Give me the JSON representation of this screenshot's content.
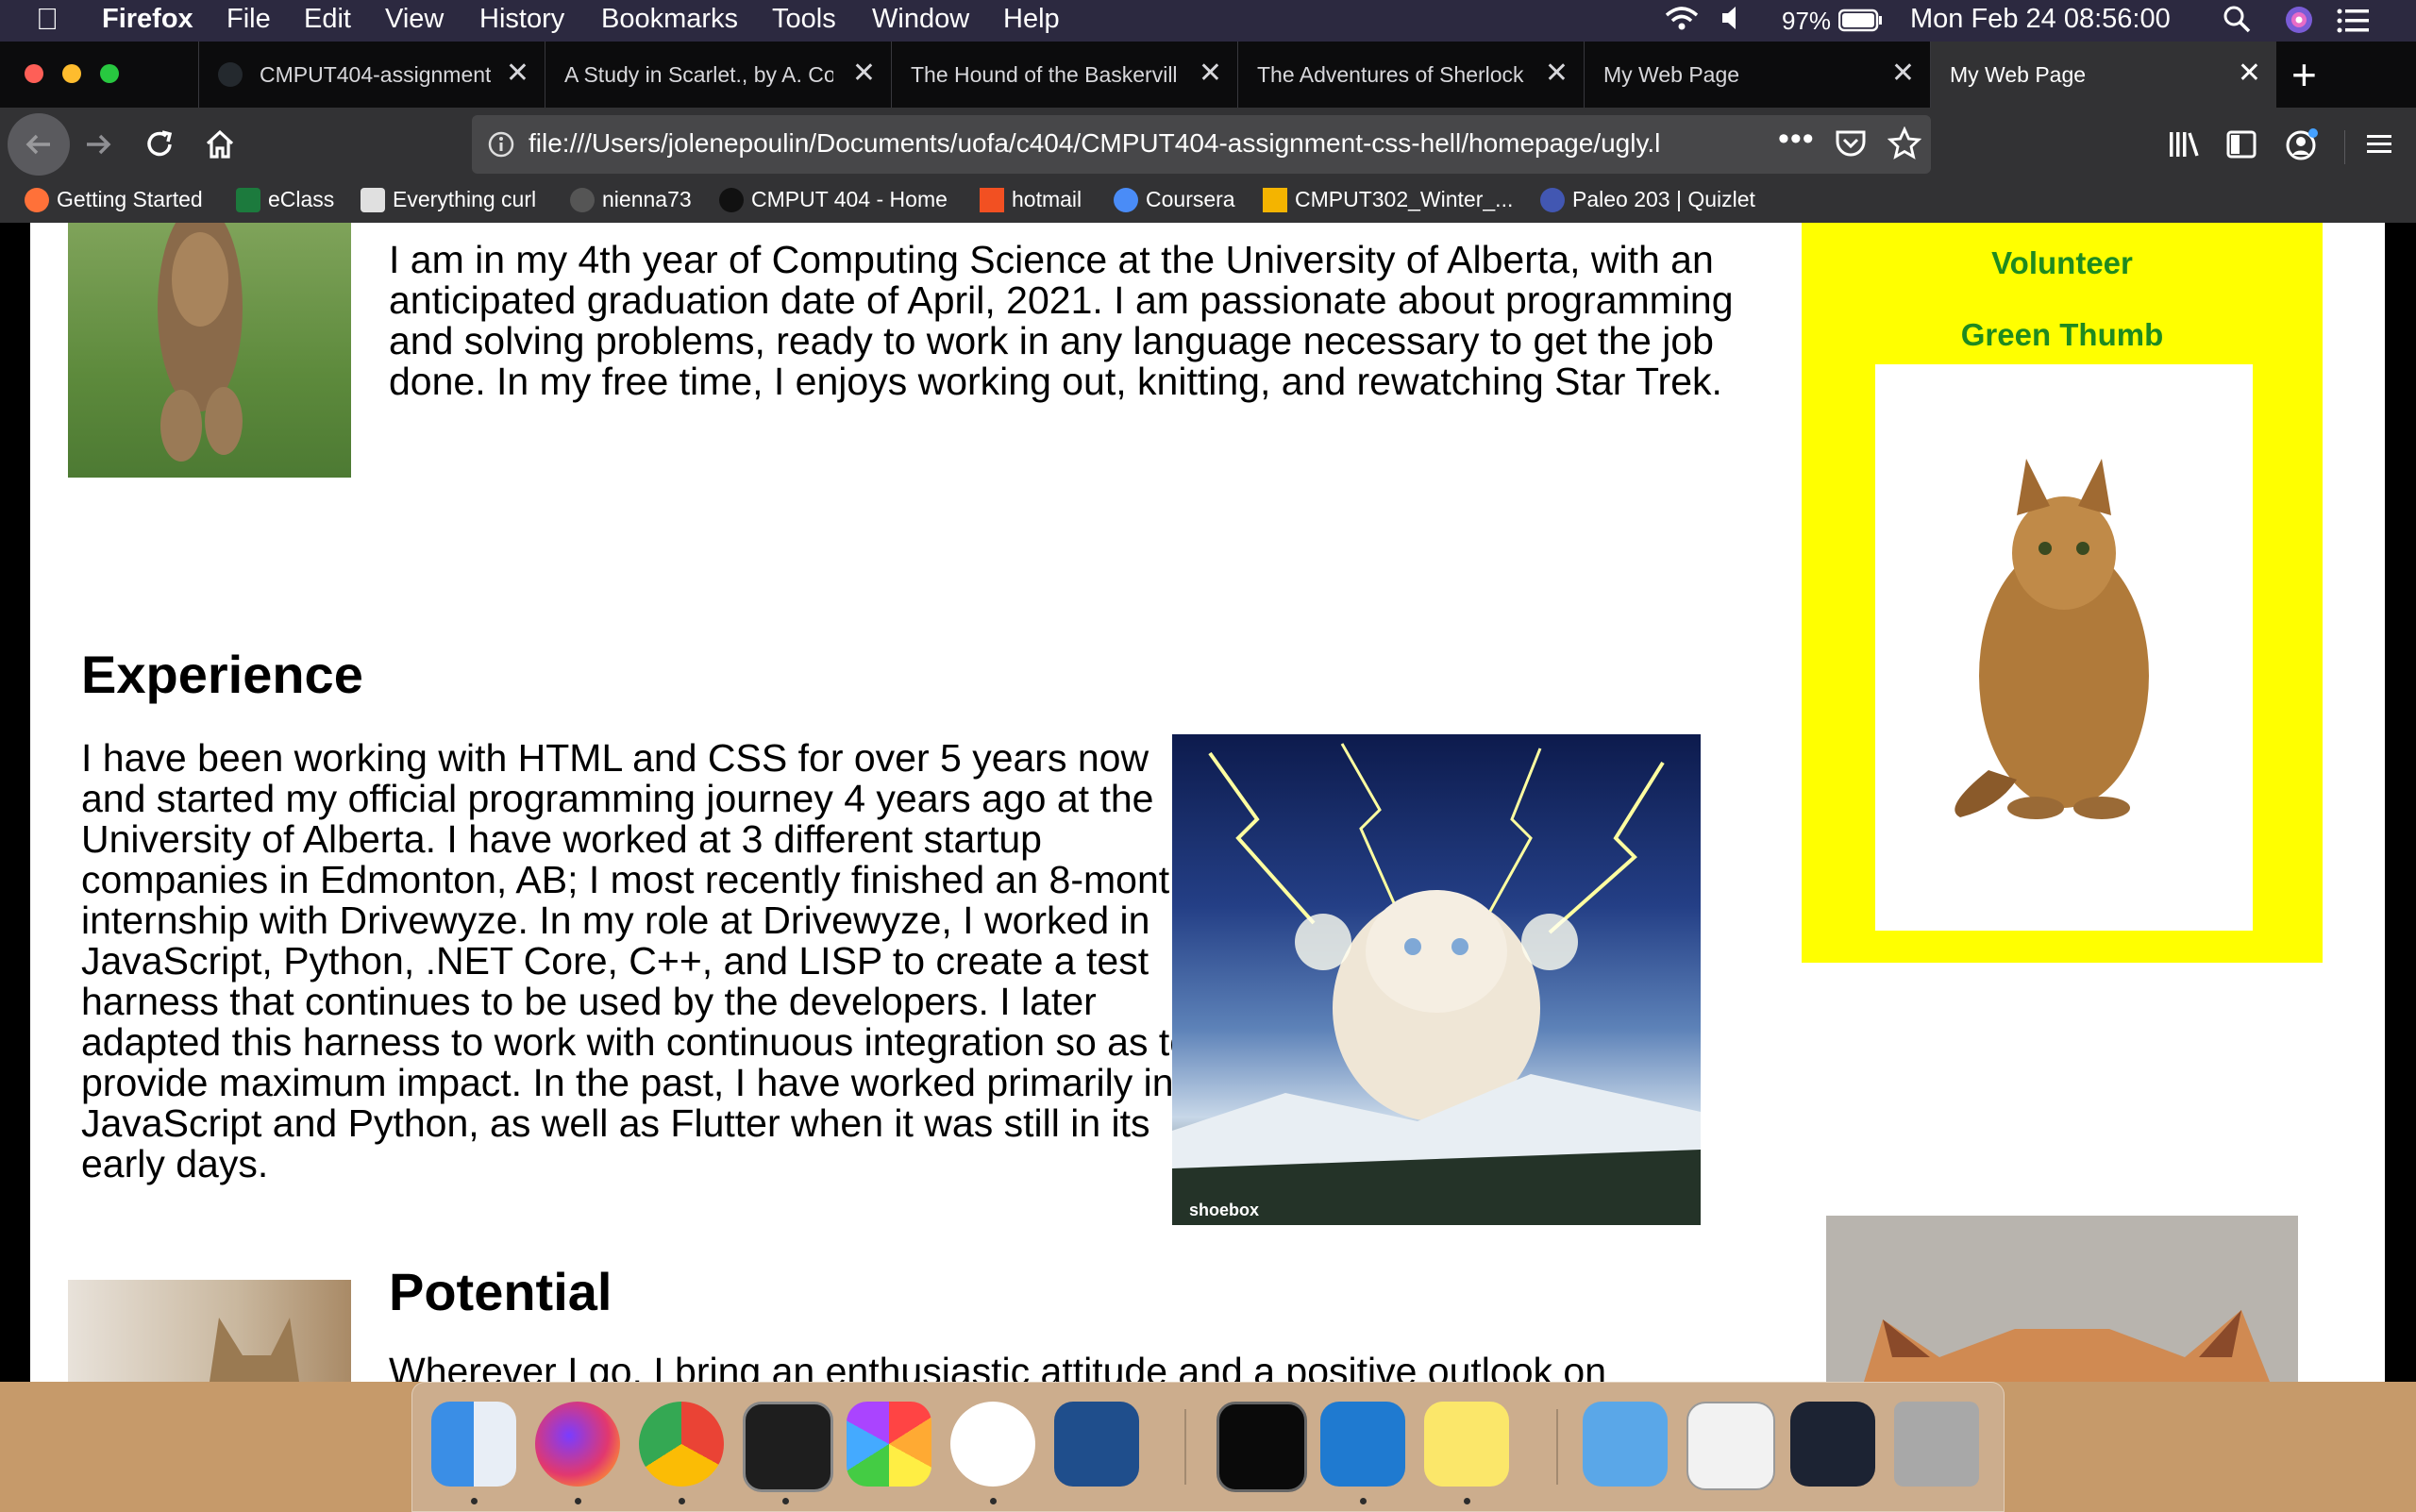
{
  "menubar": {
    "app": "Firefox",
    "items": [
      "File",
      "Edit",
      "View",
      "History",
      "Bookmarks",
      "Tools",
      "Window",
      "Help"
    ],
    "battery": "97%",
    "datetime": "Mon Feb 24  08:56:00"
  },
  "tabs": [
    {
      "title": "CMPUT404-assignment"
    },
    {
      "title": "A Study in Scarlet., by A. Co"
    },
    {
      "title": "The Hound of the Baskervill"
    },
    {
      "title": "The Adventures of Sherlock"
    },
    {
      "title": "My Web Page"
    },
    {
      "title": "My Web Page"
    }
  ],
  "address_bar": {
    "url": "file:///Users/jolenepoulin/Documents/uofa/c404/CMPUT404-assignment-css-hell/homepage/ugly.l"
  },
  "bookmarks": [
    {
      "label": "Getting Started",
      "icon": "firefox-icon",
      "color": "#ff7139"
    },
    {
      "label": "eClass",
      "icon": "eclass-icon",
      "color": "#1c7a3d"
    },
    {
      "label": "Everything curl",
      "icon": "curl-icon",
      "color": "#e0e0e0"
    },
    {
      "label": "nienna73",
      "icon": "github-icon",
      "color": "#555555"
    },
    {
      "label": "CMPUT 404 - Home",
      "icon": "404-icon",
      "color": "#111111"
    },
    {
      "label": "hotmail",
      "icon": "microsoft-icon",
      "color": "#f25022"
    },
    {
      "label": "Coursera",
      "icon": "coursera-icon",
      "color": "#4a8cf7"
    },
    {
      "label": "CMPUT302_Winter_...",
      "icon": "drive-icon",
      "color": "#f4b400"
    },
    {
      "label": "Paleo 203 | Quizlet",
      "icon": "quizlet-icon",
      "color": "#4257b2"
    }
  ],
  "page": {
    "intro_text": "I am in my 4th year of Computing Science at the University of Alberta, with an anticipated graduation date of April, 2021. I am passionate about programming and solving problems, ready to work in any language necessary to get the job done. In my free time, I enjoys working out, knitting, and rewatching Star Trek.",
    "experience_heading": "Experience",
    "experience_text": "I have been working with HTML and CSS for over 5 years now and started my official programming journey 4 years ago at the University of Alberta. I have worked at 3 different startup companies in Edmonton, AB; I most recently finished an 8-month internship with Drivewyze. In my role at Drivewyze, I worked in JavaScript, Python, .NET Core, C++, and LISP to create a test harness that continues to be used by the developers. I later adapted this harness to work with continuous integration so as to provide maximum impact. In the past, I have worked primarily in JavaScript and Python, as well as Flutter when it was still in its early days.",
    "potential_heading": "Potential",
    "potential_text": "Wherever I go, I bring an enthusiastic attitude and a positive outlook on",
    "sidebar": {
      "items": [
        "Volunteer",
        "Green Thumb"
      ],
      "bg_color": "#ffff00",
      "text_color": "#1f8a1f"
    },
    "image_watermark": "shoebox"
  },
  "colors": {
    "menubar": "#2c2940",
    "tabstrip": "#0c0c0d",
    "toolbar": "#323234",
    "urlbar": "#474749"
  }
}
